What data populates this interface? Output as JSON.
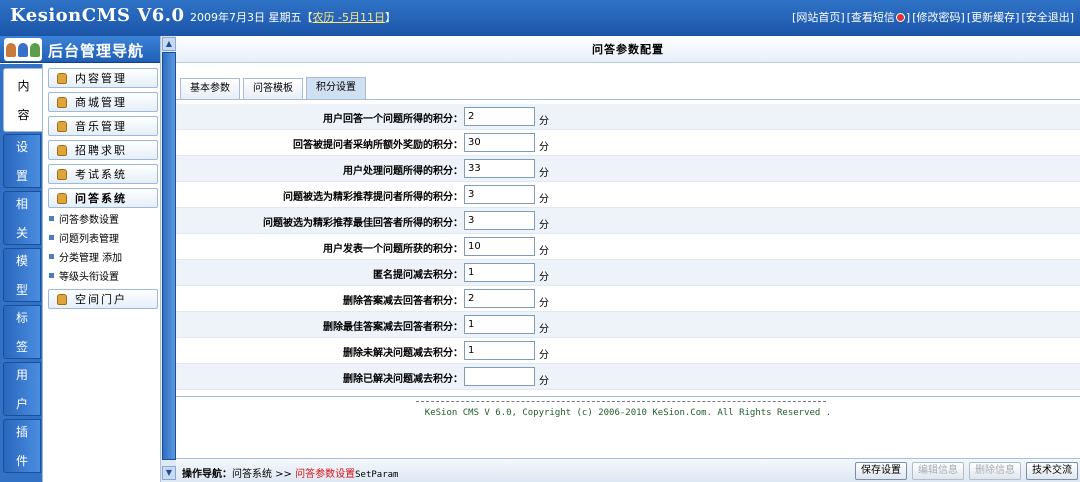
{
  "header": {
    "logo": "KesionCMS V6.0",
    "date": "2009年7月3日 星期五【",
    "lunar": "农历 -5月11日",
    "date_close": "】",
    "links": [
      "[网站首页]",
      "[查看短信",
      "]",
      "[修改密码]",
      "[更新缓存]",
      "[安全退出]"
    ]
  },
  "nav": {
    "title": "后台管理导航",
    "side_tabs": [
      {
        "l1": "内",
        "l2": "容"
      },
      {
        "l1": "设",
        "l2": "置"
      },
      {
        "l1": "相",
        "l2": "关"
      },
      {
        "l1": "模",
        "l2": "型"
      },
      {
        "l1": "标",
        "l2": "签"
      },
      {
        "l1": "用",
        "l2": "户"
      },
      {
        "l1": "插",
        "l2": "件"
      }
    ],
    "menu": [
      "内容管理",
      "商城管理",
      "音乐管理",
      "招聘求职",
      "考试系统",
      "问答系统",
      "空间门户"
    ],
    "submenu": [
      "问答参数设置",
      "问题列表管理",
      "分类管理 添加",
      "等级头衔设置"
    ]
  },
  "main": {
    "title": "问答参数配置",
    "tabs": [
      "基本参数",
      "问答模板",
      "积分设置"
    ],
    "active_tab": "积分设置",
    "rows": [
      {
        "label": "用户回答一个问题所得的积分：",
        "value": "2",
        "unit": "分"
      },
      {
        "label": "回答被提问者采纳所额外奖励的积分：",
        "value": "30",
        "unit": "分"
      },
      {
        "label": "用户处理问题所得的积分：",
        "value": "33",
        "unit": "分"
      },
      {
        "label": "问题被选为精彩推荐提问者所得的积分：",
        "value": "3",
        "unit": "分"
      },
      {
        "label": "问题被选为精彩推荐最佳回答者所得的积分：",
        "value": "3",
        "unit": "分"
      },
      {
        "label": "用户发表一个问题所获的积分：",
        "value": "10",
        "unit": "分"
      },
      {
        "label": "匿名提问减去积分：",
        "value": "1",
        "unit": "分"
      },
      {
        "label": "删除答案减去回答者积分：",
        "value": "2",
        "unit": "分"
      },
      {
        "label": "删除最佳答案减去回答者积分：",
        "value": "1",
        "unit": "分"
      },
      {
        "label": "删除未解决问题减去积分：",
        "value": "1",
        "unit": "分"
      },
      {
        "label": "删除已解决问题减去积分：",
        "value": "",
        "unit": "分"
      }
    ],
    "copyright": "KeSion CMS V 6.0, Copyright (c) 2006-2010 KeSion.Com. All Rights Reserved ."
  },
  "status": {
    "label": "操作导航：",
    "path": "问答系统 >> ",
    "current": "问答参数设置",
    "code": "SetParam",
    "buttons": [
      {
        "label": "保存设置",
        "enabled": true
      },
      {
        "label": "编辑信息",
        "enabled": false
      },
      {
        "label": "删除信息",
        "enabled": false
      },
      {
        "label": "技术交流",
        "enabled": true
      }
    ]
  }
}
